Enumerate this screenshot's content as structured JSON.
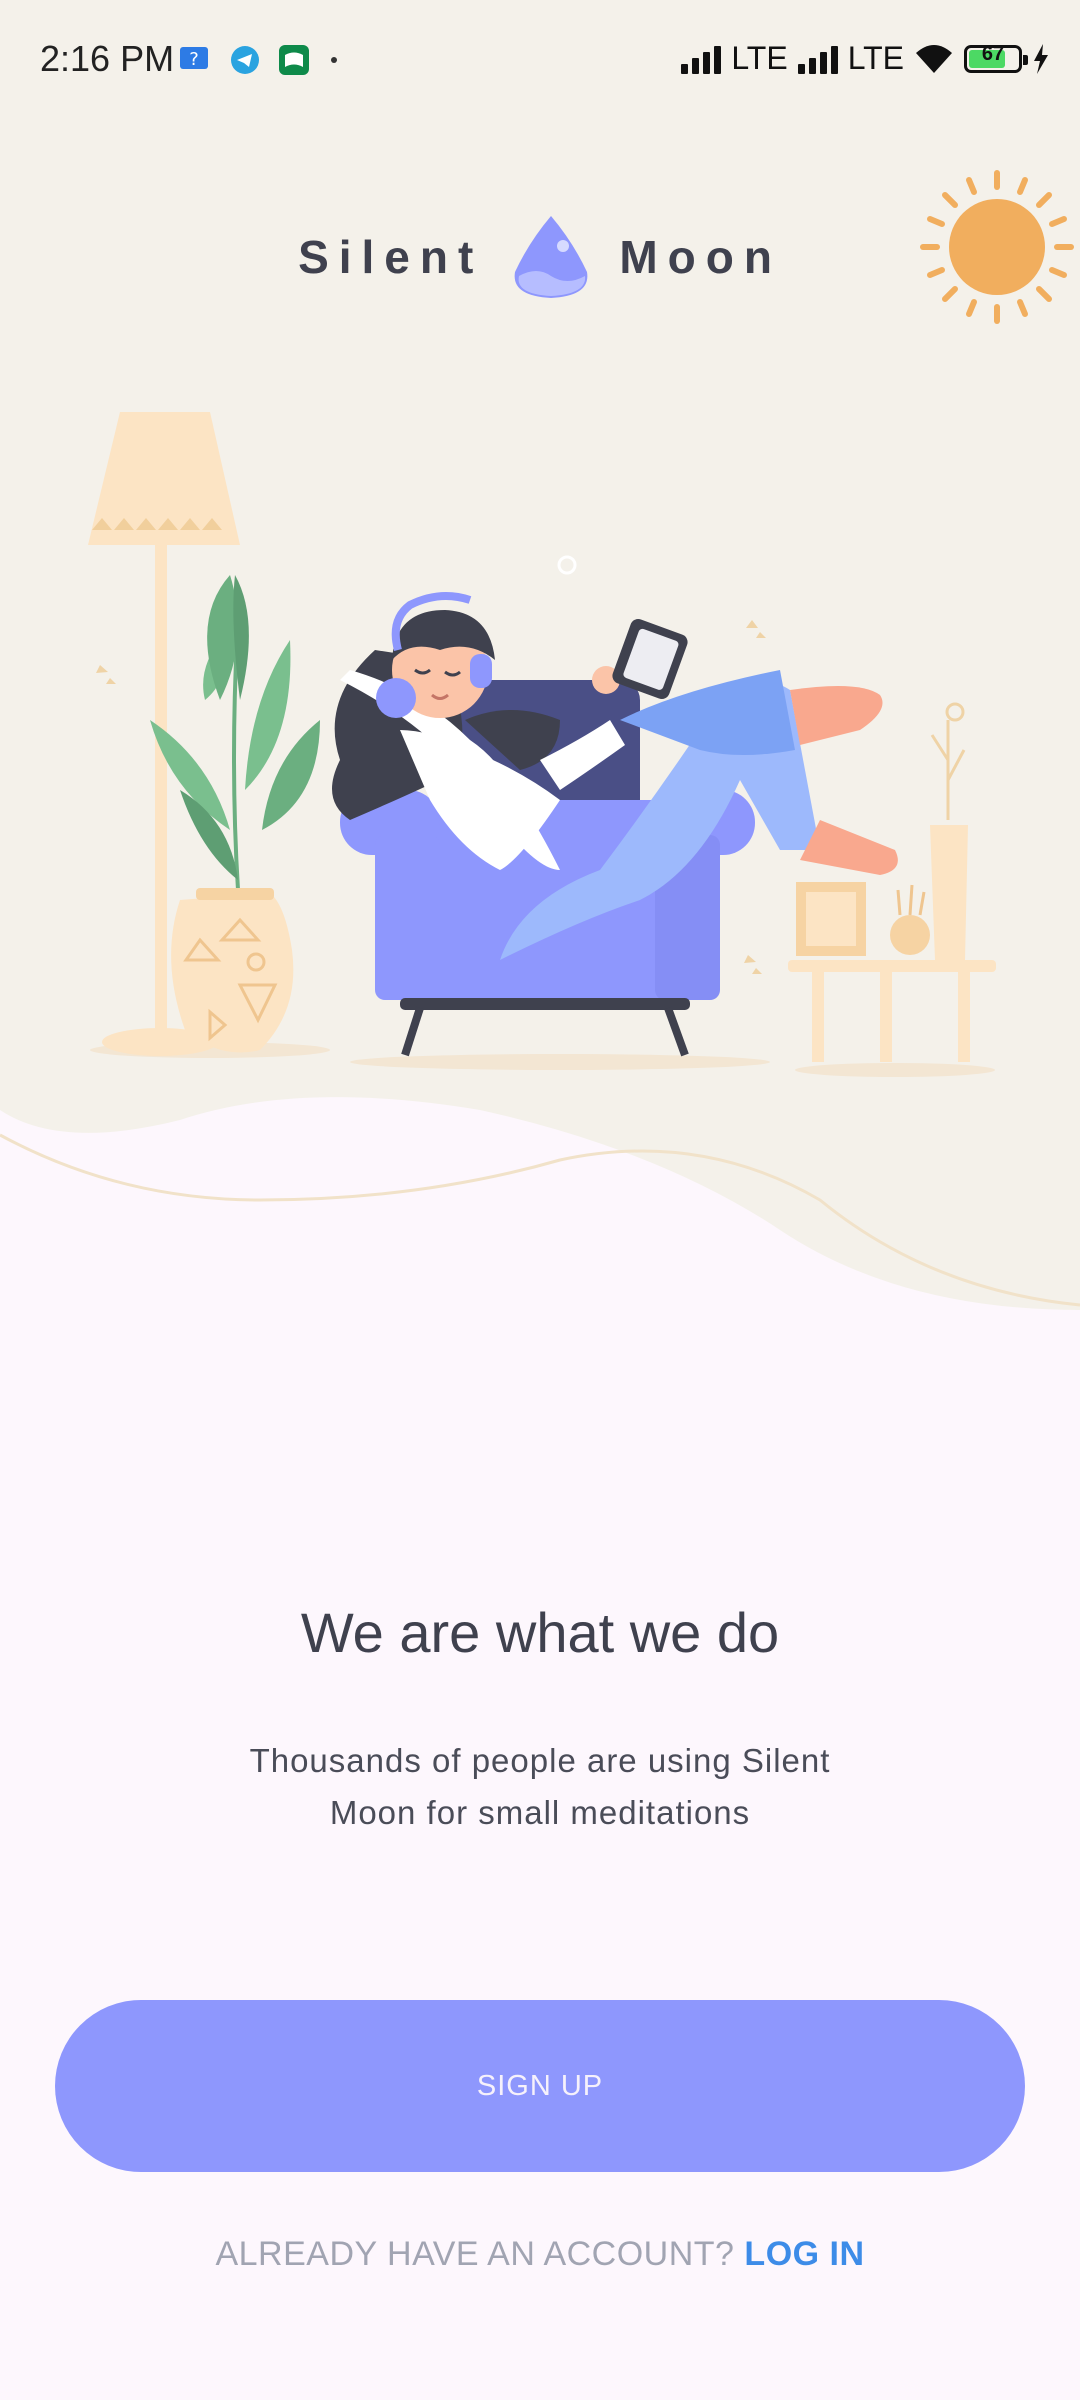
{
  "status_bar": {
    "time": "2:16 PM",
    "notification_icons": [
      "help-app-icon",
      "telegram-icon",
      "books-app-icon"
    ],
    "network_1": "LTE",
    "network_2": "LTE",
    "battery_level": "67"
  },
  "brand": {
    "word_left": "Silent",
    "word_right": "Moon",
    "logo_icon": "moon-drop-logo-icon"
  },
  "colors": {
    "accent": "#8E97FD",
    "hero_bg": "#F4F1EA",
    "page_bg": "#FDF7FD",
    "link": "#3D8CE8",
    "sun": "#F1AE5E"
  },
  "content": {
    "headline": "We are what we do",
    "subtext": "Thousands of people are using Silent Moon for small meditations"
  },
  "actions": {
    "signup_label": "SIGN UP",
    "login_prompt": "ALREADY HAVE AN ACCOUNT?",
    "login_label": "LOG IN"
  }
}
